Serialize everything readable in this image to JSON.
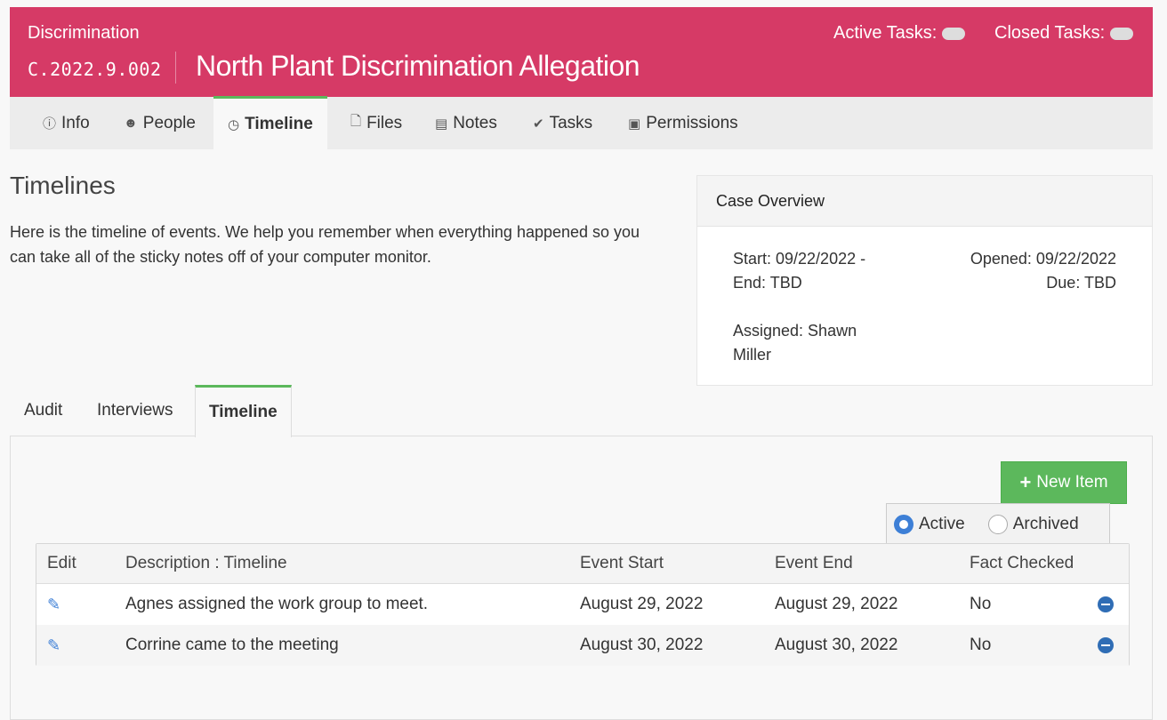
{
  "header": {
    "case_type": "Discrimination",
    "case_number": "C.2022.9.002",
    "case_title": "North Plant Discrimination Allegation",
    "active_tasks_label": "Active Tasks:",
    "closed_tasks_label": "Closed Tasks:"
  },
  "nav": {
    "info": "Info",
    "people": "People",
    "timeline": "Timeline",
    "files": "Files",
    "notes": "Notes",
    "tasks": "Tasks",
    "permissions": "Permissions"
  },
  "page": {
    "heading": "Timelines",
    "intro": "Here is the timeline of events. We help you remember when everything happened so you can take all of the sticky notes off of your computer monitor."
  },
  "overview": {
    "title": "Case Overview",
    "start": "Start: 09/22/2022 -",
    "end": "End: TBD",
    "opened": "Opened: 09/22/2022",
    "due": "Due: TBD",
    "assigned_1": "Assigned: Shawn",
    "assigned_2": "Miller"
  },
  "subtabs": {
    "audit": "Audit",
    "interviews": "Interviews",
    "timeline": "Timeline"
  },
  "toolbar": {
    "new_item": "New Item",
    "active": "Active",
    "archived": "Archived"
  },
  "table": {
    "headers": {
      "edit": "Edit",
      "description": "Description : Timeline",
      "event_start": "Event Start",
      "event_end": "Event End",
      "fact_checked": "Fact Checked"
    },
    "rows": [
      {
        "description": "Agnes assigned the work group to meet.",
        "event_start": "August 29, 2022",
        "event_end": "August 29, 2022",
        "fact_checked": "No"
      },
      {
        "description": "Corrine came to the meeting",
        "event_start": "August 30, 2022",
        "event_end": "August 30, 2022",
        "fact_checked": "No"
      }
    ]
  },
  "colors": {
    "brand": "#d63a66",
    "accent_green": "#5cb85c",
    "link_blue": "#3d7fd6"
  }
}
